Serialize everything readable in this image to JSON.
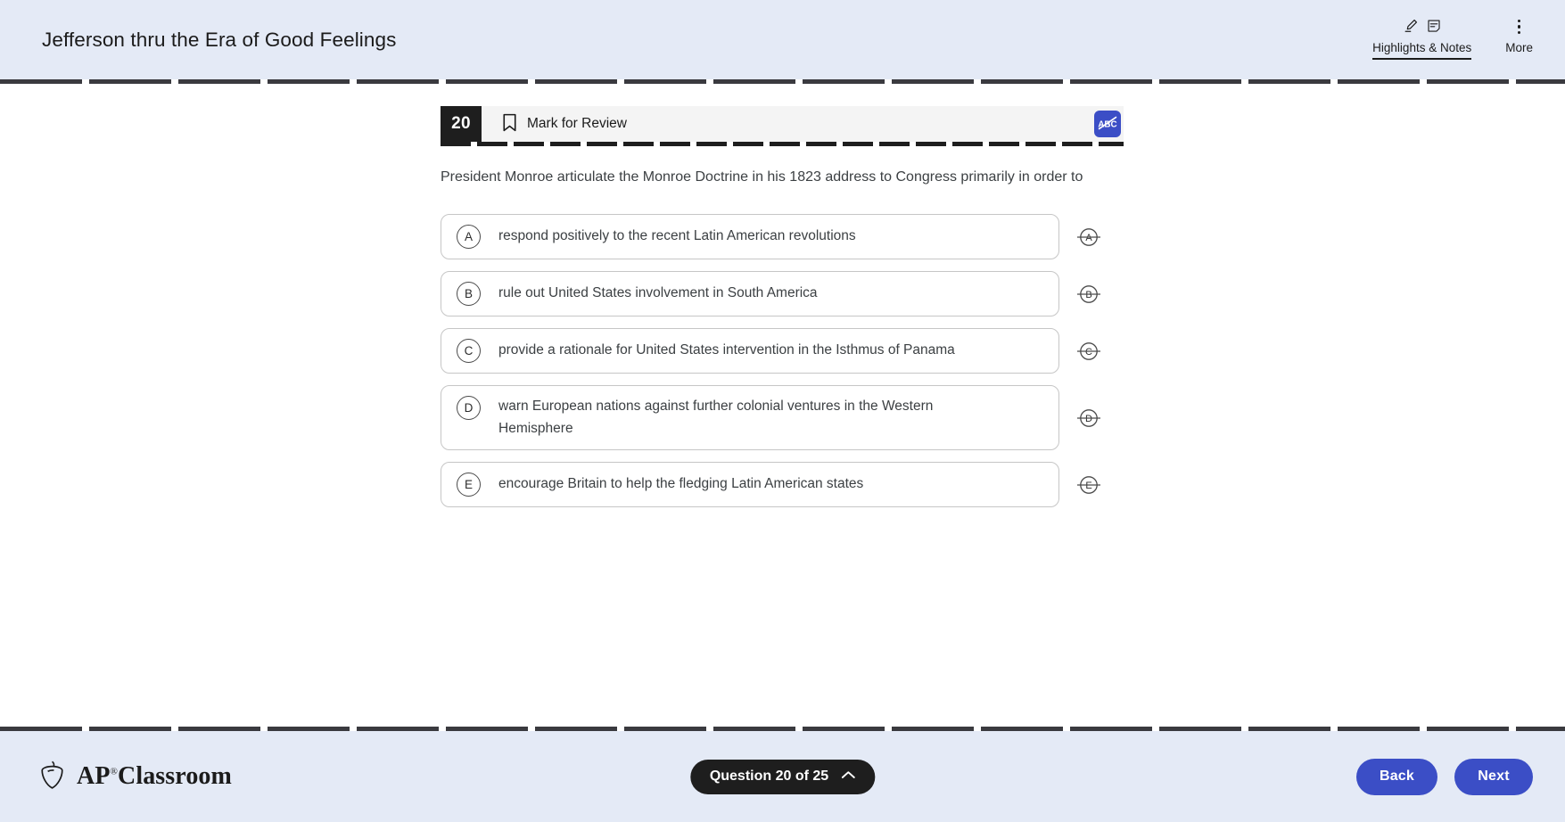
{
  "header": {
    "title": "Jefferson thru the Era of Good Feelings",
    "tools": [
      {
        "label": "Highlights & Notes",
        "icons": [
          "highlighter-icon",
          "note-icon"
        ],
        "active": true
      },
      {
        "label": "More",
        "icons": [
          "more-vertical-icon"
        ],
        "active": false
      }
    ]
  },
  "question": {
    "number": "20",
    "mark_for_review_label": "Mark for Review",
    "eliminator_tool_label": "ABC",
    "stem": "President Monroe articulate the Monroe Doctrine in his 1823 address to Congress primarily in order to",
    "choices": [
      {
        "letter": "A",
        "text": "respond positively to the recent Latin American revolutions"
      },
      {
        "letter": "B",
        "text": "rule out United States involvement in South America"
      },
      {
        "letter": "C",
        "text": "provide a rationale for United States intervention in the Isthmus of Panama"
      },
      {
        "letter": "D",
        "text": "warn European nations against further colonial ventures in the Western Hemisphere"
      },
      {
        "letter": "E",
        "text": "encourage Britain to help the fledging Latin American states"
      }
    ]
  },
  "footer": {
    "brand": "Classroom",
    "brand_prefix": "AP",
    "brand_registered": "®",
    "progress_label": "Question 20 of 25",
    "back_label": "Back",
    "next_label": "Next"
  },
  "colors": {
    "chrome_background": "#e4eaf6",
    "accent_blue": "#3b4ec6",
    "dark": "#1e1e1e",
    "question_bar": "#f4f4f4",
    "text": "#3c4043"
  }
}
